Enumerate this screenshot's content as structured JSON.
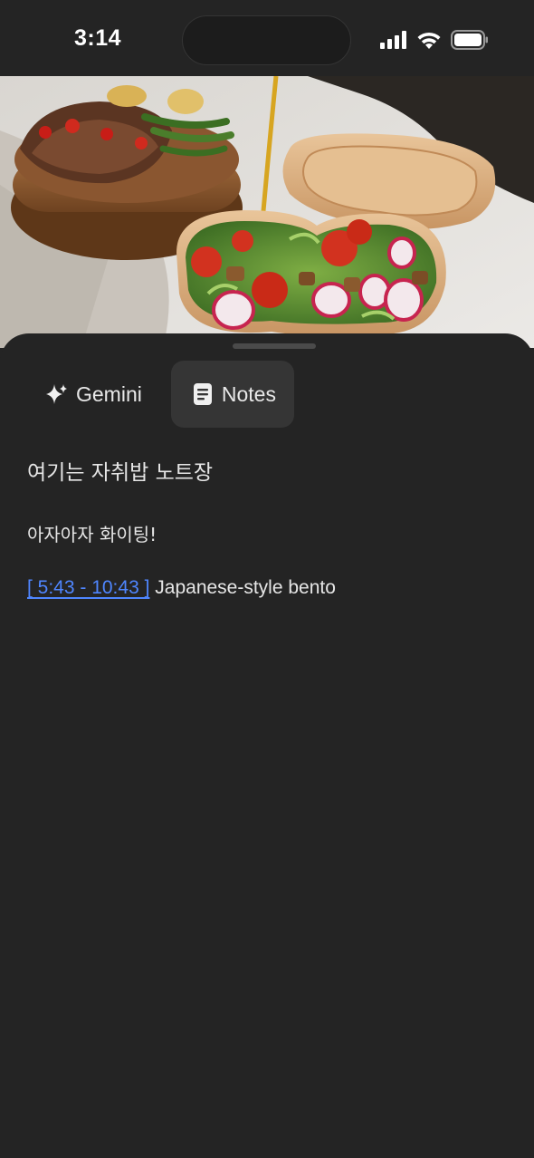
{
  "status_bar": {
    "time": "3:14"
  },
  "video": {
    "thumbnail": "bento-food-photo"
  },
  "tabs": [
    {
      "label": "Gemini",
      "icon": "sparkle-icon",
      "active": false
    },
    {
      "label": "Notes",
      "icon": "document-icon",
      "active": true
    }
  ],
  "notes": {
    "title": "여기는 자취밥 노트장",
    "line1": "아자아자 화이팅!",
    "timestamp": "[ 5:43 - 10:43 ]",
    "timestamp_note": "Japanese-style bento"
  },
  "colors": {
    "background": "#242424",
    "link": "#4f86ff",
    "text": "#e6e6e6",
    "active_tab": "#353535"
  }
}
